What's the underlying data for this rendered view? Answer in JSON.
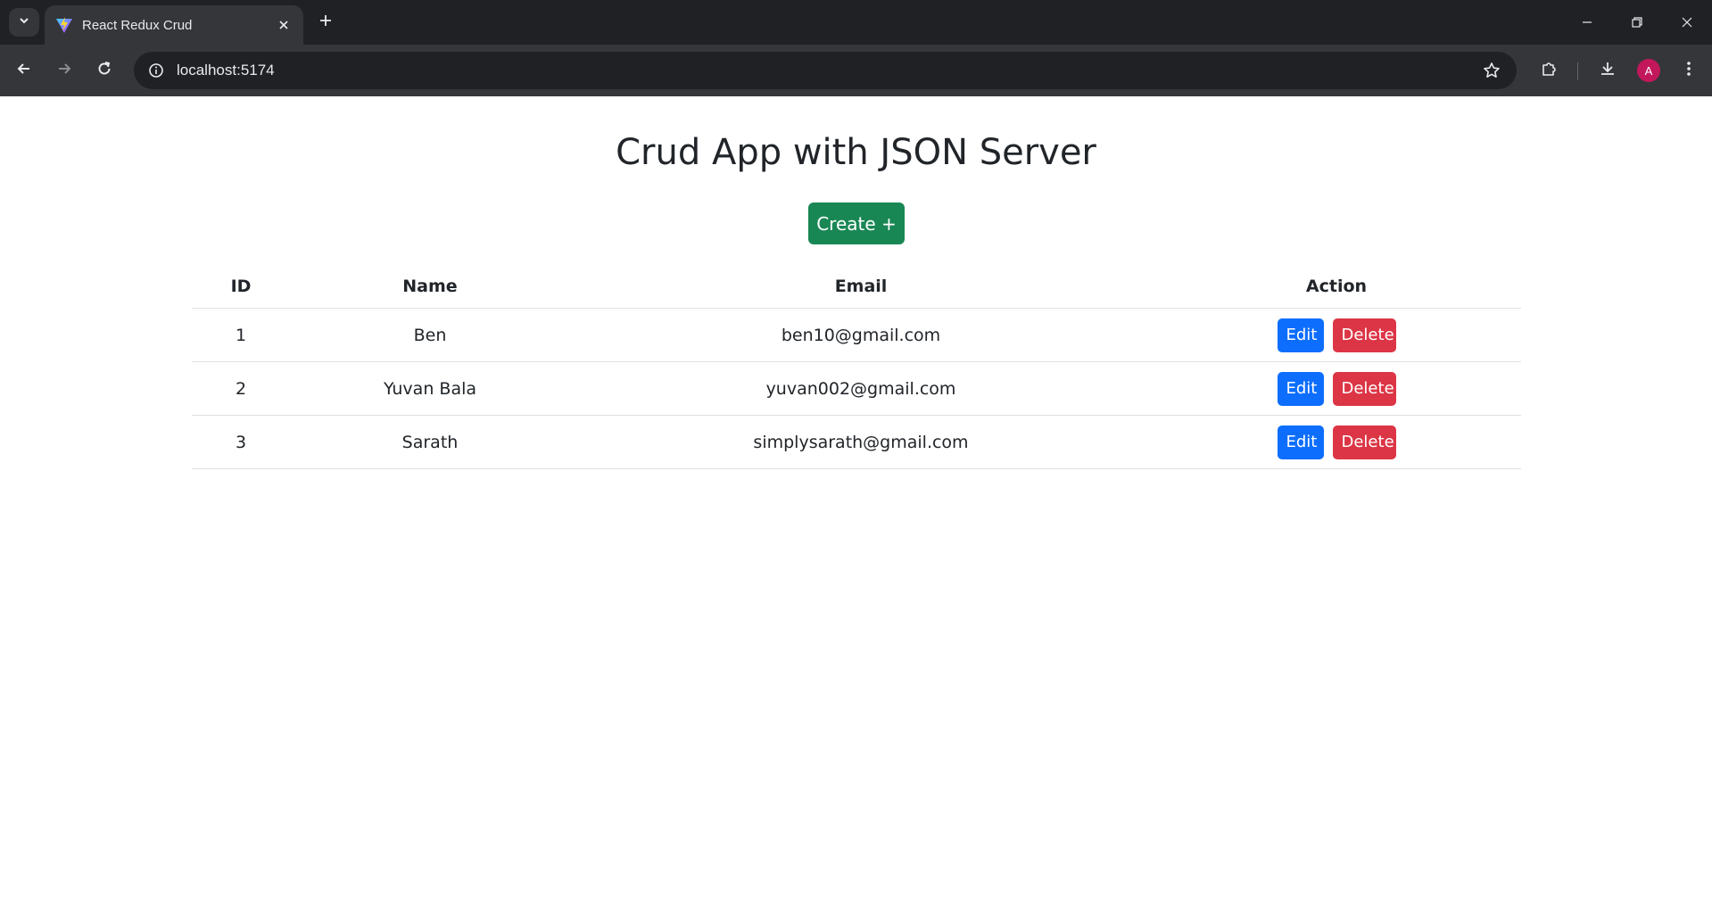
{
  "browser": {
    "tab_title": "React Redux Crud",
    "url": "localhost:5174",
    "profile_initial": "A",
    "icons": {
      "tab_search": "chevron-down-icon",
      "favicon": "vite-logo-icon",
      "close": "close-icon",
      "new_tab": "plus-icon",
      "back": "arrow-left-icon",
      "forward": "arrow-right-icon",
      "reload": "reload-icon",
      "site_info": "info-icon",
      "bookmark": "star-icon",
      "extensions": "puzzle-icon",
      "downloads": "download-icon",
      "menu": "kebab-menu-icon"
    }
  },
  "page": {
    "title": "Crud App with JSON Server",
    "create_label": "Create +",
    "table": {
      "headers": {
        "id": "ID",
        "name": "Name",
        "email": "Email",
        "action": "Action"
      },
      "rows": [
        {
          "id": "1",
          "name": "Ben",
          "email": "ben10@gmail.com"
        },
        {
          "id": "2",
          "name": "Yuvan Bala",
          "email": "yuvan002@gmail.com"
        },
        {
          "id": "3",
          "name": "Sarath",
          "email": "simplysarath@gmail.com"
        }
      ],
      "edit_label": "Edit",
      "delete_label": "Delete"
    }
  },
  "colors": {
    "create": "#198754",
    "edit": "#0d6efd",
    "delete": "#dc3545",
    "avatar": "#c2185b"
  }
}
